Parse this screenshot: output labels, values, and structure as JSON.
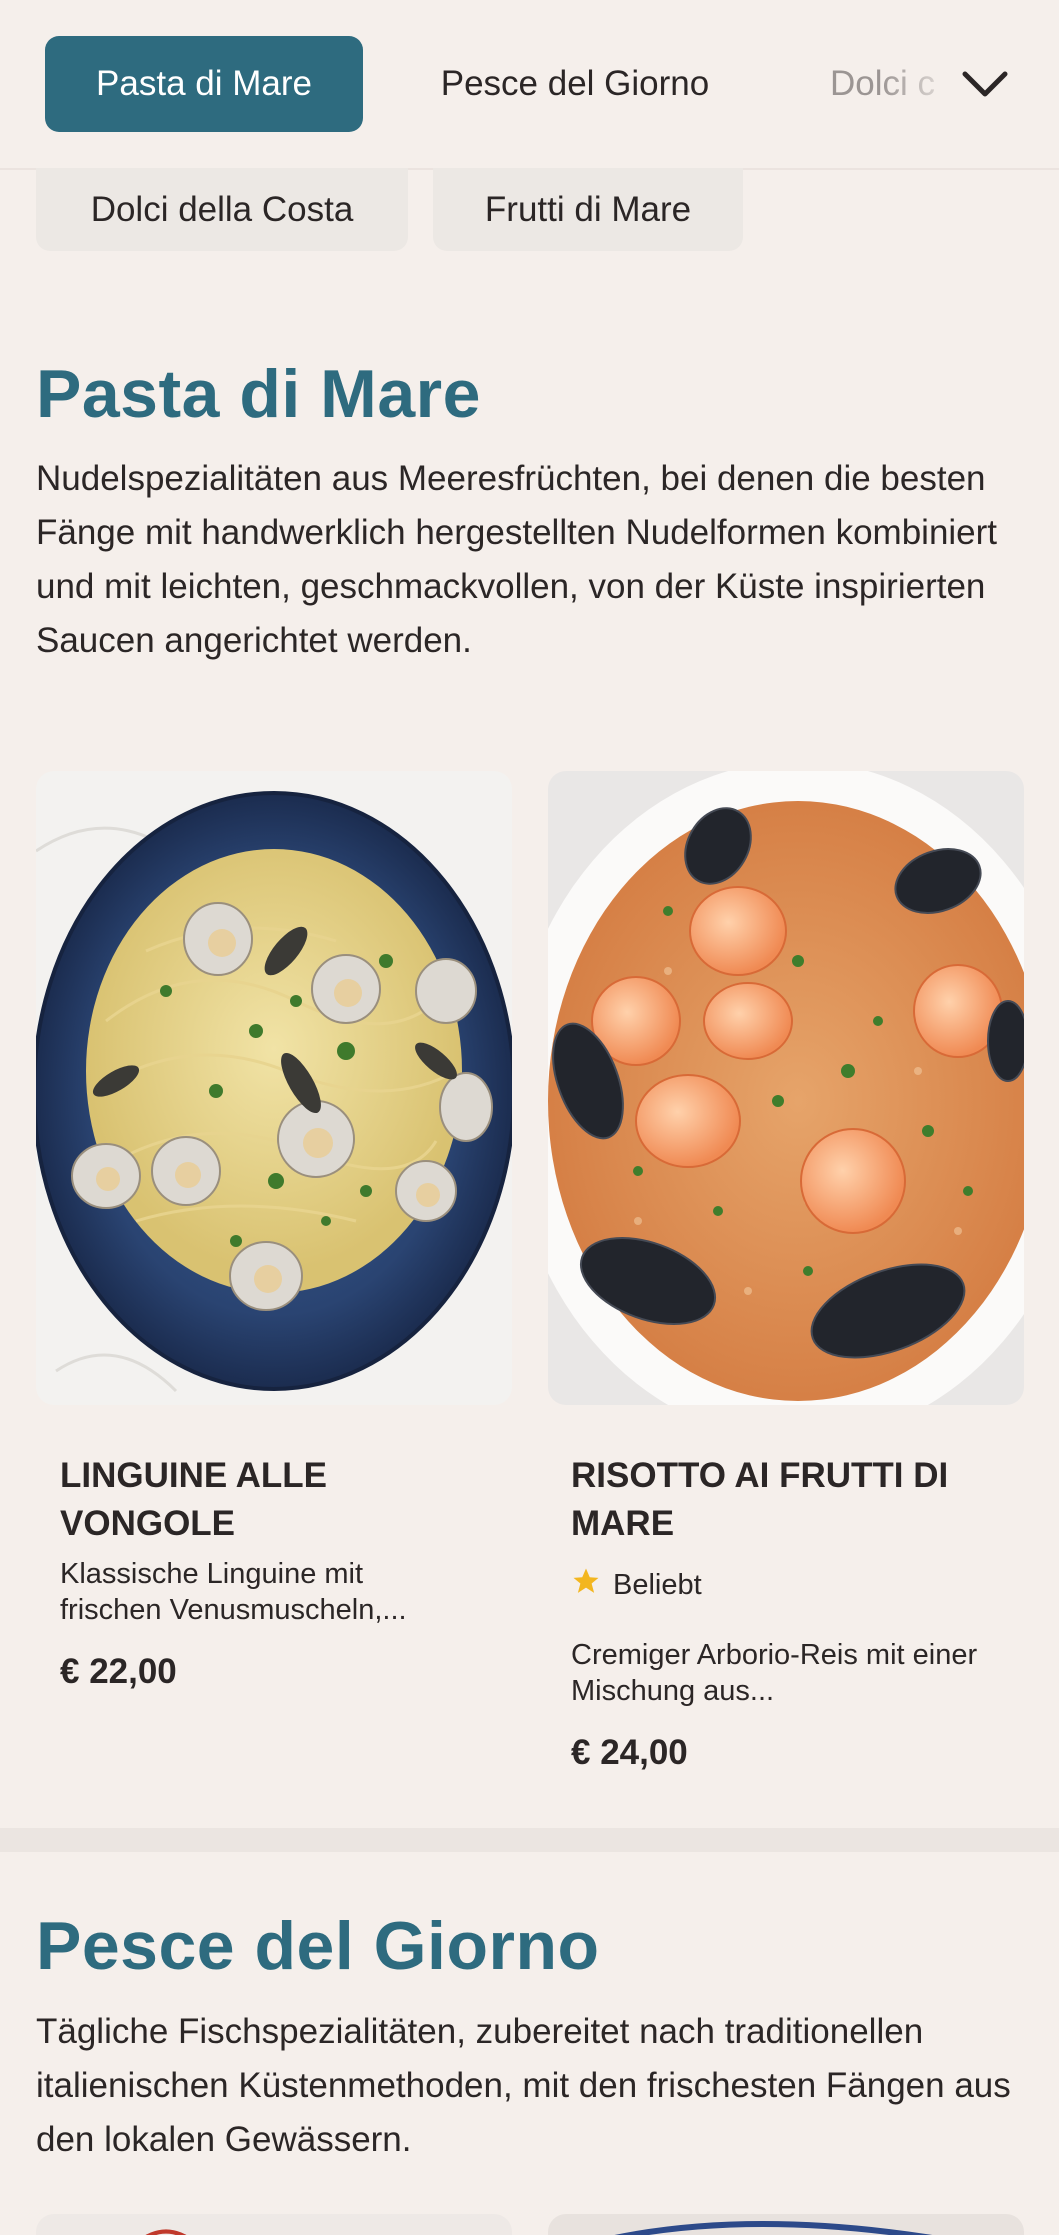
{
  "nav": {
    "categories": [
      "Pasta di Mare",
      "Pesce del Giorno",
      "Dolci c"
    ],
    "chips": [
      "Dolci della Costa",
      "Frutti di Mare"
    ]
  },
  "sections": [
    {
      "title": "Pasta di Mare",
      "description": "Nudelspezialitäten aus Meeresfrüchten, bei denen die besten Fänge mit handwerklich hergestellten Nudelformen kombiniert und mit leichten, geschmackvollen, von der Küste inspirierten Saucen angerichtet werden.",
      "dishes": [
        {
          "name": "LINGUINE ALLE VONGOLE",
          "description": "Klassische Linguine mit frischen Venusmuscheln,...",
          "price": "€ 22,00"
        },
        {
          "name": "RISOTTO AI FRUTTI DI MARE",
          "badge": "Beliebt",
          "description": "Cremiger Arborio-Reis mit einer Mischung aus...",
          "price": "€ 24,00"
        }
      ]
    },
    {
      "title": "Pesce del Giorno",
      "description": "Tägliche Fischspezialitäten, zubereitet nach traditionellen italienischen Küstenmethoden, mit den frischesten Fängen aus den lokalen Gewässern."
    }
  ],
  "colors": {
    "accent": "#2e6b7f",
    "background": "#f5efeb",
    "star": "#f3b61f"
  },
  "icons": [
    "chevron-down-icon",
    "star-icon"
  ]
}
